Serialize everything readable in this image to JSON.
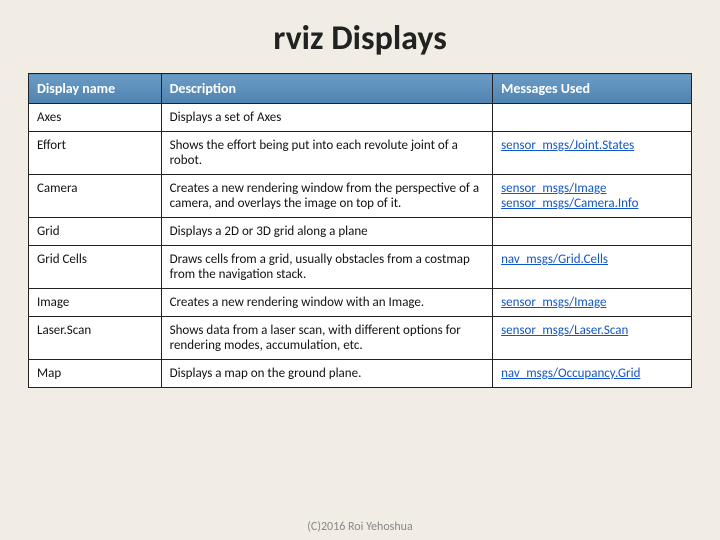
{
  "title": "rviz Displays",
  "headers": {
    "name": "Display name",
    "desc": "Description",
    "msgs": "Messages Used"
  },
  "rows": [
    {
      "name": "Axes",
      "desc": "Displays a set of Axes",
      "msgs": []
    },
    {
      "name": "Effort",
      "desc": "Shows the effort being put into each revolute joint of a robot.",
      "msgs": [
        "sensor_msgs/Joint.States"
      ]
    },
    {
      "name": "Camera",
      "desc": "Creates a new rendering window from the perspective of a camera, and overlays the image on top of it.",
      "msgs": [
        "sensor_msgs/Image",
        "sensor_msgs/Camera.Info"
      ]
    },
    {
      "name": "Grid",
      "desc": "Displays a 2D or 3D grid along a plane",
      "msgs": []
    },
    {
      "name": "Grid Cells",
      "desc": "Draws cells from a grid, usually obstacles from a costmap from the navigation stack.",
      "msgs": [
        "nav_msgs/Grid.Cells"
      ]
    },
    {
      "name": "Image",
      "desc": "Creates a new rendering window with an Image.",
      "msgs": [
        "sensor_msgs/Image"
      ]
    },
    {
      "name": "Laser.Scan",
      "desc": "Shows data from a laser scan, with different options for rendering modes, accumulation, etc.",
      "msgs": [
        "sensor_msgs/Laser.Scan"
      ]
    },
    {
      "name": "Map",
      "desc": "Displays a map on the ground plane.",
      "msgs": [
        "nav_msgs/Occupancy.Grid"
      ]
    }
  ],
  "footer": "(C)2016 Roi Yehoshua"
}
